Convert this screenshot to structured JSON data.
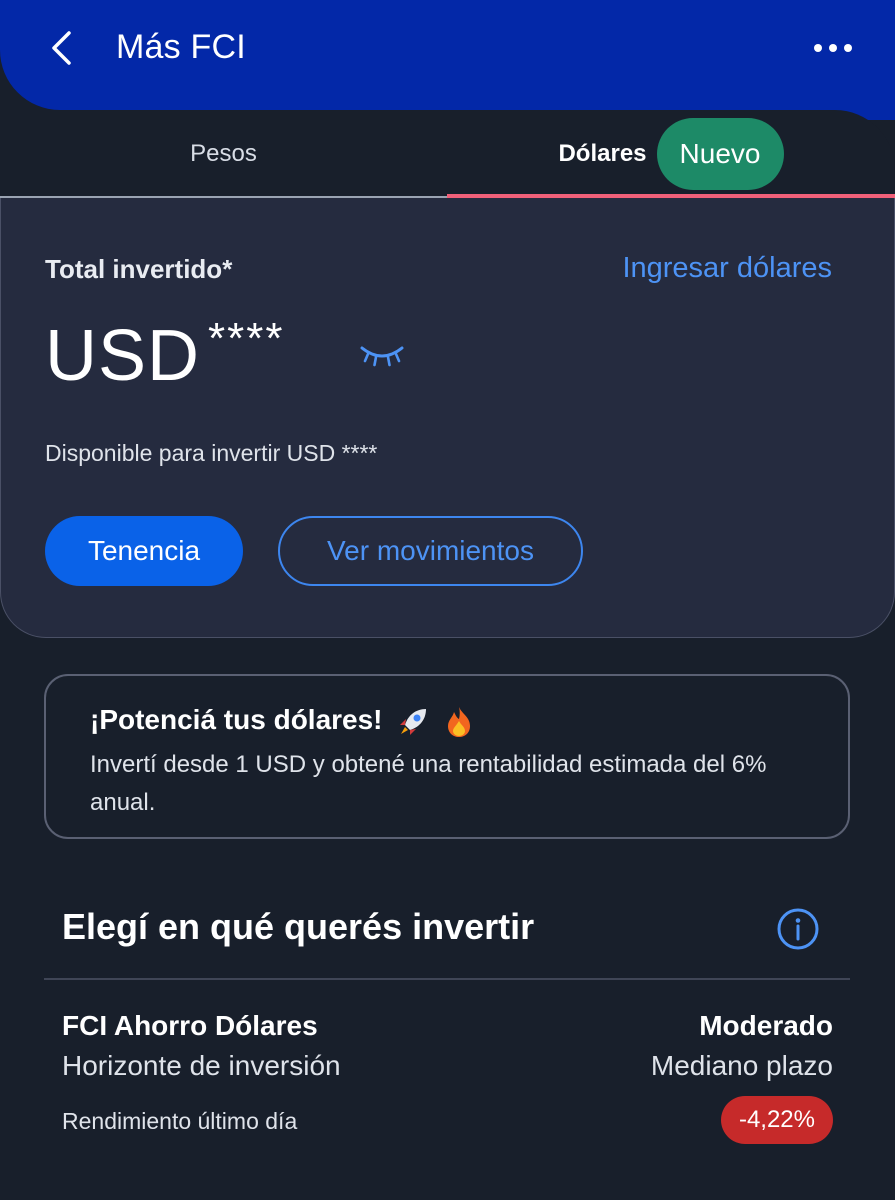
{
  "header": {
    "title": "Más FCI",
    "back_icon": "chevron-left-icon",
    "more_icon": "more-horizontal-icon"
  },
  "tabs": [
    {
      "label": "Pesos",
      "active": false
    },
    {
      "label": "Dólares",
      "active": true,
      "badge": "Nuevo"
    }
  ],
  "summary": {
    "total_label": "Total invertido*",
    "ingresar_link": "Ingresar dólares",
    "currency": "USD",
    "amount_masked": "****",
    "eye_icon": "eye-closed-icon",
    "disponible": "Disponible para invertir USD ****",
    "tenencia_button": "Tenencia",
    "movimientos_button": "Ver movimientos"
  },
  "promo": {
    "title": "¡Potenciá tus dólares!",
    "body": "Invertí desde 1 USD y obtené una rentabilidad estimada del 6% anual."
  },
  "section": {
    "title": "Elegí en qué querés invertir",
    "info_icon": "info-icon"
  },
  "fund": {
    "name": "FCI Ahorro Dólares",
    "risk": "Moderado",
    "horizon_label": "Horizonte de inversión",
    "horizon_value": "Mediano plazo",
    "yield_label": "Rendimiento último día",
    "yield_value": "-4,22%"
  },
  "colors": {
    "header_bg": "#0328a8",
    "page_bg": "#181f2b",
    "card_bg": "#252b3f",
    "primary_blue": "#0a62e8",
    "link_blue": "#4d93f5",
    "badge_green": "#1d8a67",
    "tab_accent": "#f06079",
    "negative_red": "#c62a2a"
  }
}
